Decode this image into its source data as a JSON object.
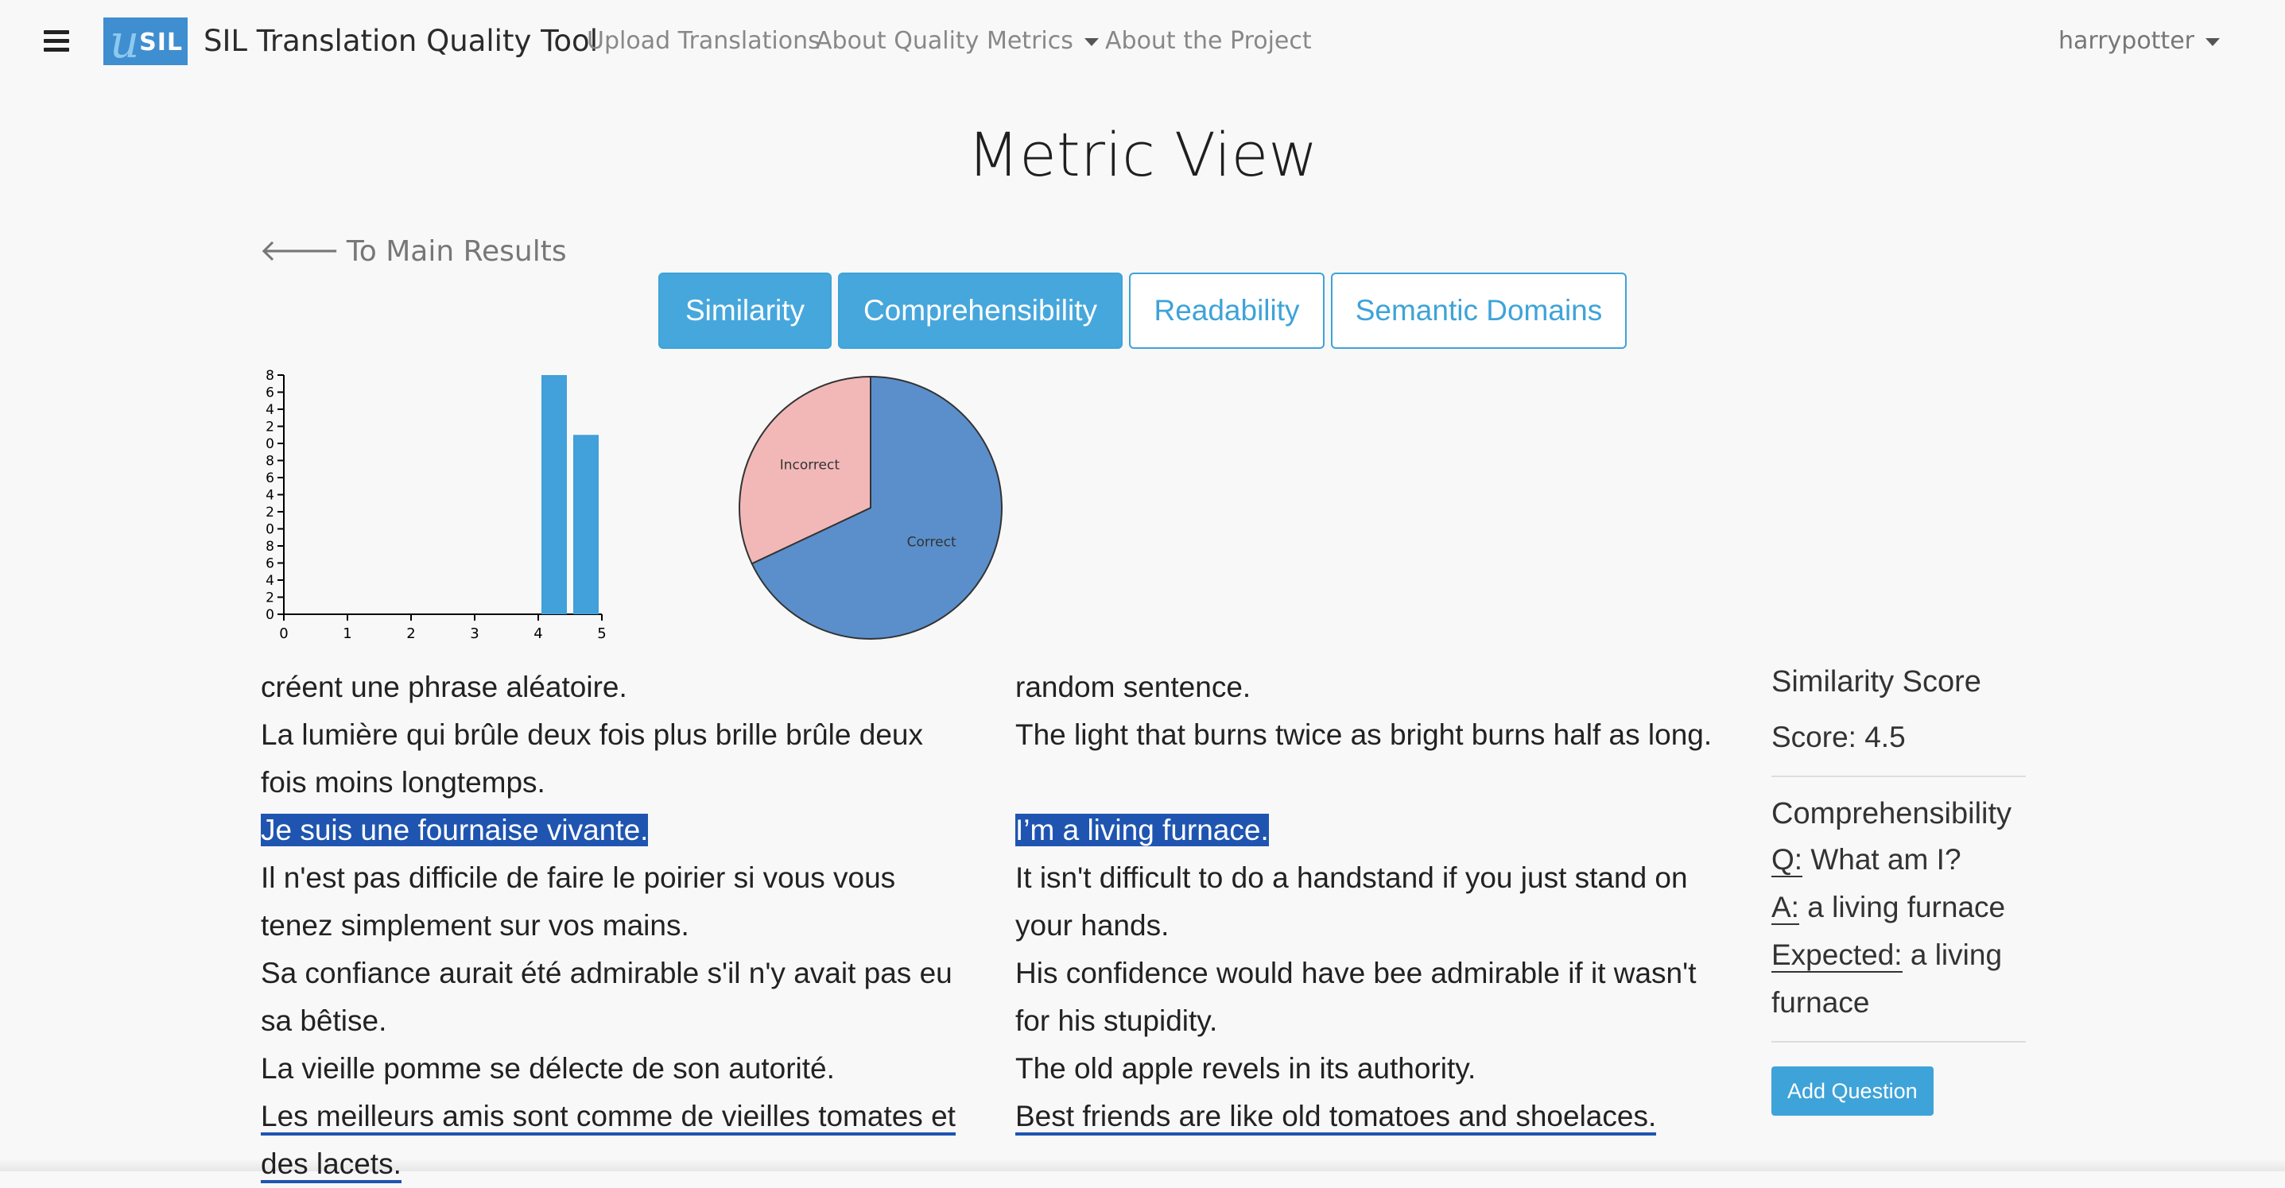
{
  "nav": {
    "brand": "SIL Translation Quality Tool",
    "logo_text": "SIL",
    "links": {
      "upload": "Upload Translations",
      "about_metrics": "About Quality Metrics",
      "about_project": "About the Project"
    },
    "user": "harrypotter"
  },
  "page": {
    "title": "Metric View",
    "back": "To Main Results"
  },
  "tabs": [
    "Similarity",
    "Comprehensibility",
    "Readability",
    "Semantic Domains"
  ],
  "chart_data": [
    {
      "type": "bar",
      "x": [
        4.25,
        4.75
      ],
      "values": [
        8,
        6
      ],
      "xlim": [
        0,
        5
      ],
      "xticks": [
        "0",
        "1",
        "2",
        "3",
        "4",
        "5"
      ],
      "yticks": [
        "0",
        "2",
        "4",
        "6",
        "8",
        "0",
        "2",
        "4",
        "6",
        "8",
        "0",
        "2",
        "4",
        "6",
        "8"
      ],
      "color": "#42a0da"
    },
    {
      "type": "pie",
      "labels": [
        "Correct",
        "Incorrect"
      ],
      "values": [
        0.68,
        0.32
      ],
      "colors": [
        "#5a8fcb",
        "#f2b8b8"
      ]
    }
  ],
  "source_lines": [
    "créent une phrase aléatoire.",
    "La lumière qui brûle deux fois plus brille brûle deux fois moins longtemps.",
    "Je suis une fournaise vivante.",
    "Il n'est pas difficile de faire le poirier si vous vous tenez simplement sur vos mains.",
    "Sa confiance aurait été admirable s'il n'y avait pas eu sa bêtise.",
    "La vieille pomme se délecte de son autorité.",
    "Les meilleurs amis sont comme de vieilles tomates et des lacets."
  ],
  "target_lines": [
    "random sentence.",
    "The light that burns twice as bright burns half as long.",
    "I’m a living furnace.",
    "It isn't difficult to do a handstand if you just stand on your hands.",
    "His confidence would have bee admirable if it wasn't for his stupidity.",
    "The old apple revels in its authority.",
    "Best friends are like old tomatoes and shoelaces."
  ],
  "sidebar": {
    "similarity_title": "Similarity Score",
    "score": "Score: 4.5",
    "comp_title": "Comprehensibility",
    "q_label": "Q:",
    "question": "What am I?",
    "a_label": "A:",
    "answer": "a living furnace",
    "exp_label": "Expected:",
    "expected": "a living furnace",
    "add_button": "Add Question"
  }
}
